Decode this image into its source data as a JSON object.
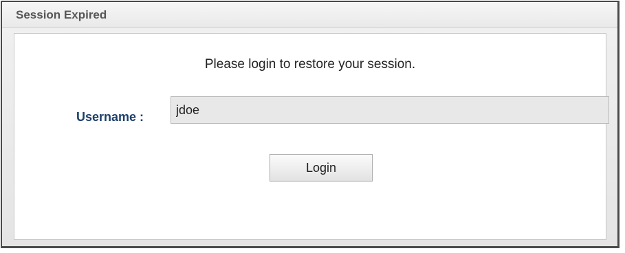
{
  "dialog": {
    "title": "Session Expired",
    "message": "Please login to restore your session.",
    "username": {
      "label": "Username :",
      "value": "jdoe"
    },
    "login_label": "Login"
  }
}
